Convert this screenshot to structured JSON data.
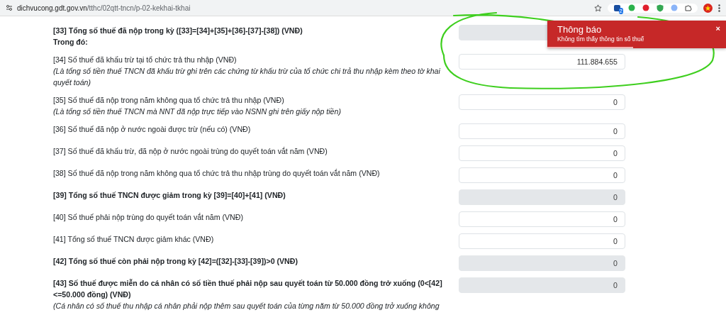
{
  "browser": {
    "url_domain": "dichvucong.gdt.gov.vn",
    "url_path": "/tthc/02qtt-tncn/p-02-kekhai-tkhai",
    "extension_badge": "2"
  },
  "form": {
    "rows": [
      {
        "label": "[33] Tổng số thuế đã nộp trong kỳ ([33]=[34]+[35]+[36]-[37]-[38]) (VNĐ)",
        "bold": true,
        "subheading": "Trong đó:",
        "disabled": true
      },
      {
        "label": "[34] Số thuế đã khấu trừ tại tổ chức trả thu nhập (VNĐ)",
        "bold": false,
        "note": "(Là tổng số tiền thuế TNCN đã khấu trừ ghi trên các chứng từ khấu trừ của tổ chức chi trả thu nhập kèm theo tờ khai quyết toán)",
        "value": "111.884.655",
        "disabled": false
      },
      {
        "label": "[35] Số thuế đã nộp trong năm không qua tổ chức trả thu nhập (VNĐ)",
        "bold": false,
        "note": "(Là tổng số tiền thuế TNCN mà NNT đã nộp trực tiếp vào NSNN ghi trên giấy nộp tiền)",
        "value": "0",
        "disabled": false
      },
      {
        "label": "[36] Số thuế đã nộp ở nước ngoài được trừ (nếu có) (VNĐ)",
        "bold": false,
        "value": "0",
        "disabled": false
      },
      {
        "label": "[37] Số thuế đã khấu trừ, đã nộp ở nước ngoài trùng do quyết toán vắt năm (VNĐ)",
        "bold": false,
        "value": "0",
        "disabled": false
      },
      {
        "label": "[38] Số thuế đã nộp trong năm không qua tổ chức trả thu nhập trùng do quyết toán vắt năm (VNĐ)",
        "bold": false,
        "value": "0",
        "disabled": false
      },
      {
        "label": "[39] Tổng số thuế TNCN được giảm trong kỳ [39]=[40]+[41] (VNĐ)",
        "bold": true,
        "value": "0",
        "disabled": true
      },
      {
        "label": "[40] Số thuế phải nộp trùng do quyết toán vắt năm (VNĐ)",
        "bold": false,
        "value": "0",
        "disabled": false
      },
      {
        "label": "[41] Tổng số thuế TNCN được giảm khác (VNĐ)",
        "bold": false,
        "value": "0",
        "disabled": false
      },
      {
        "label": "[42] Tổng số thuế còn phải nộp trong kỳ [42]=([32]-[33]-[39])>0 (VNĐ)",
        "bold": true,
        "value": "0",
        "disabled": true
      },
      {
        "label": "[43] Số thuế được miễn do cá nhân có số tiền thuế phải nộp sau quyết toán từ 50.000 đồng trở xuống (0<[42] <=50.000 đồng) (VNĐ)",
        "bold": true,
        "note": "(Cá nhân có số thuế thu nhập cá nhân phải nộp thêm sau quyết toán của từng năm từ 50.000 đồng trở xuống không",
        "value": "0",
        "disabled": true
      }
    ]
  },
  "toast": {
    "title": "Thông báo",
    "message": "Không tìm thấy thông tin số thuế",
    "close": "×",
    "level": 0.48
  }
}
